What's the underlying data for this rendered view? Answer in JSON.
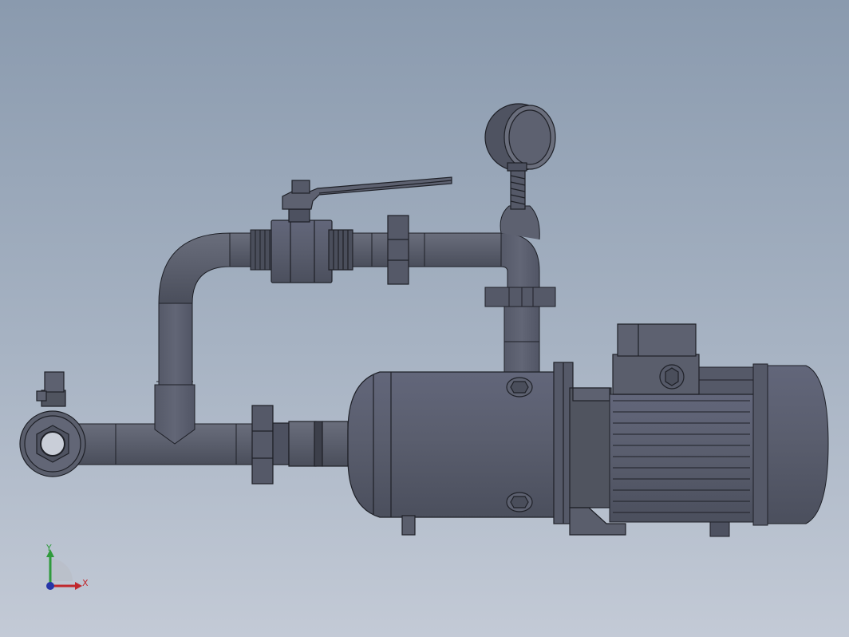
{
  "viewport": {
    "background_top": "#8a9aae",
    "background_bottom": "#c3cad6",
    "part_fill": "#5d6170",
    "part_dark": "#3c3f4a",
    "part_light": "#6d7180",
    "edge_color": "#1e2027"
  },
  "triad": {
    "x_label": "X",
    "y_label": "Y",
    "x_color": "#c0282d",
    "y_color": "#2f9a3c",
    "z_color": "#2636a8"
  },
  "model": {
    "components": [
      "suction-inlet-fitting",
      "suction-pipe",
      "tee-fitting",
      "bypass-pipe-elbow",
      "ball-valve",
      "valve-handle",
      "union-coupling",
      "pressure-gauge",
      "discharge-riser",
      "pump-housing",
      "electric-motor",
      "terminal-box"
    ]
  }
}
